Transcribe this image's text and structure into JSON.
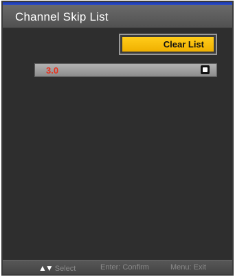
{
  "title": "Channel Skip List",
  "buttons": {
    "clear_list": "Clear List"
  },
  "skip_list": [
    {
      "channel": "3.0",
      "skipped": true
    }
  ],
  "footer": {
    "select_arrows_icon": "up-down-arrows-icon",
    "select_arrows": "▲▼",
    "select_label": "Select",
    "confirm_label": "Enter: Confirm",
    "exit_label": "Menu: Exit"
  },
  "colors": {
    "accent_yellow": "#ffcc1a",
    "channel_text_red": "#e8321e",
    "panel_bg": "#2e2e2e",
    "title_bar": "#5e5e5e",
    "top_accent_blue": "#2a4ac8"
  }
}
